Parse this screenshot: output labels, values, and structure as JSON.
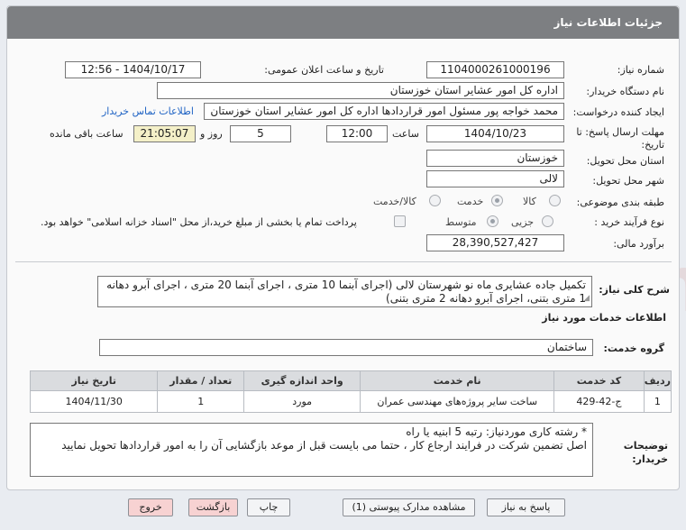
{
  "header": {
    "title": "جزئیات اطلاعات نیاز"
  },
  "form": {
    "need_number": {
      "label": "شماره نیاز:",
      "value": "1104000261000196"
    },
    "announce_datetime": {
      "label": "تاریخ و ساعت اعلان عمومی:",
      "value": "1404/10/17 - 12:56"
    },
    "buyer_org": {
      "label": "نام دستگاه خریدار:",
      "value": "اداره کل امور عشایر استان خوزستان"
    },
    "creator": {
      "label": "ایجاد کننده درخواست:",
      "value": "محمد خواجه پور مسئول امور قراردادها اداره کل امور عشایر استان خوزستان",
      "contact_link": "اطلاعات تماس خریدار"
    },
    "deadline": {
      "label_line1": "مهلت ارسال پاسخ: تا",
      "label_line2": "تاریخ:",
      "date": "1404/10/23",
      "time_label": "ساعت",
      "time": "12:00",
      "days": "5",
      "days_label": "روز و",
      "remaining": "21:05:07",
      "remaining_label": "ساعت باقی مانده"
    },
    "province": {
      "label": "استان محل تحویل:",
      "value": "خوزستان"
    },
    "city": {
      "label": "شهر محل تحویل:",
      "value": "لالی"
    },
    "category": {
      "label": "طبقه بندی موضوعی:",
      "options": [
        "کالا",
        "خدمت",
        "کالا/خدمت"
      ],
      "selected": "خدمت"
    },
    "process": {
      "label": "نوع فرآیند خرید :",
      "options": [
        "جزیی",
        "متوسط"
      ],
      "selected": "متوسط",
      "treasury_note": "پرداخت تمام یا بخشی از مبلغ خرید،از محل \"اسناد خزانه اسلامی\" خواهد بود."
    },
    "estimate": {
      "label": "برآورد مالی:",
      "value": "28,390,527,427"
    }
  },
  "description": {
    "label": "شرح کلی نیاز:",
    "text": "تکمیل جاده عشایری ماه نو شهرستان لالی   (اجرای آبنما 10 متری ، اجرای آبنما 20 متری ، اجرای آبرو دهانه 1 متری بتنی،  اجرای آبرو دهانه 2 متری بتنی)"
  },
  "services": {
    "section_title": "اطلاعات خدمات مورد نیاز",
    "group_label": "گروه خدمت:",
    "group_value": "ساختمان",
    "columns": [
      "ردیف",
      "کد خدمت",
      "نام خدمت",
      "واحد اندازه گیری",
      "تعداد / مقدار",
      "تاریخ نیاز"
    ],
    "rows": [
      [
        "1",
        "ج-42-429",
        "ساخت سایر پروژه‌های مهندسی عمران",
        "مورد",
        "1",
        "1404/11/30"
      ]
    ]
  },
  "buyer_notes": {
    "label_line1": "توضیحات",
    "label_line2": "خریدار:",
    "line1": "* رشته کاری موردنیاز:   رتبه 5  ابنیه یا راه",
    "line2": "اصل تضمین شرکت در فرایند ارجاع کار ،   حتما می بایست قبل از موعد بازگشایی  آن را به امور قراردادها تحویل نمایید"
  },
  "buttons": {
    "reply": "پاسخ به نیاز",
    "view_docs": "مشاهده مدارک پیوستی (1)",
    "print": "چاپ",
    "back": "بازگشت",
    "exit": "خروج"
  },
  "watermark": {
    "text": "AriaTender.net"
  }
}
